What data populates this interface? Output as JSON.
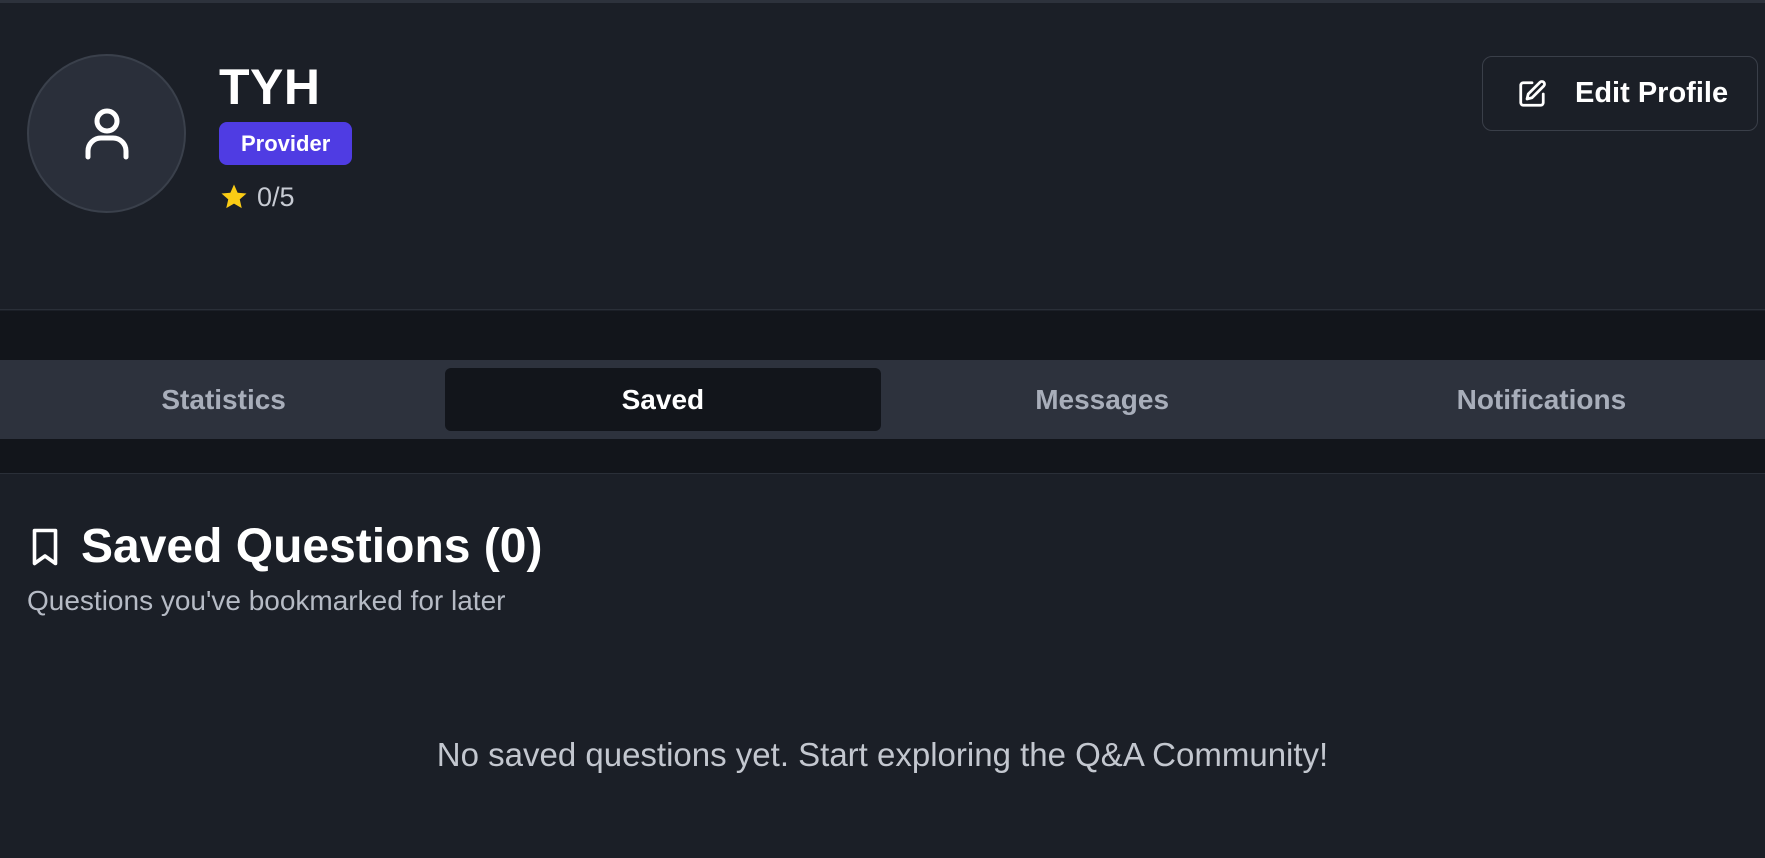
{
  "profile": {
    "name": "TYH",
    "role_badge": "Provider",
    "rating": "0/5",
    "edit_button_label": "Edit Profile"
  },
  "tabs": [
    {
      "label": "Statistics",
      "active": false
    },
    {
      "label": "Saved",
      "active": true
    },
    {
      "label": "Messages",
      "active": false
    },
    {
      "label": "Notifications",
      "active": false
    }
  ],
  "saved": {
    "title": "Saved Questions (0)",
    "subtitle": "Questions you've bookmarked for later",
    "empty_message": "No saved questions yet. Start exploring the Q&A Community!"
  },
  "icons": {
    "avatar": "user-icon",
    "rating": "star-icon",
    "edit": "edit-icon",
    "section": "bookmark-icon"
  },
  "colors": {
    "badge": "#4f3ce3",
    "star": "#facc15",
    "background": "#1b1f27",
    "tab_strip": "#2d323d"
  }
}
